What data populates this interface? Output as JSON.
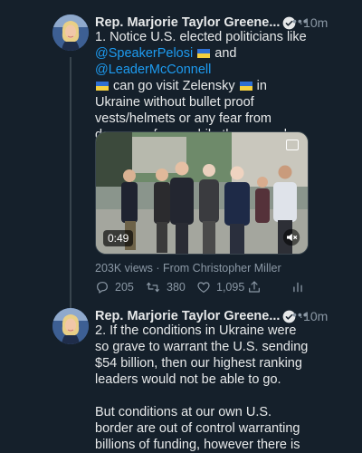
{
  "tweets": [
    {
      "author": "Rep. Marjorie Taylor Greene...",
      "separator": "·",
      "time": "10m",
      "text": {
        "t1": "1. Notice U.S. elected politicians like",
        "mention1": "@SpeakerPelosi",
        "t2": " and ",
        "mention2": "@LeaderMcConnell",
        "t3": " can go visit Zelensky ",
        "t4": " in Ukraine without bullet proof vests/helmets or any fear from dangers of war, while they eagerly give billions to fund their proxy war w/ Russia."
      },
      "media": {
        "duration": "0:49"
      },
      "views": "203K views · From Christopher Miller",
      "actions": {
        "replies": "205",
        "retweets": "380",
        "likes": "1,095"
      }
    },
    {
      "author": "Rep. Marjorie Taylor Greene...",
      "separator": "·",
      "time": "10m",
      "text": {
        "p1": "2. If the conditions in Ukraine were so grave to warrant the U.S. sending $54 billion, then our highest ranking leaders would not be able to go.",
        "p2": "But conditions at our own U.S. border are out of control warranting billions of funding, however there is baby formula there."
      }
    }
  ],
  "icons": [
    "verified-icon",
    "more-icon",
    "ukraine-flag-icon",
    "reply-icon",
    "retweet-icon",
    "like-icon",
    "share-icon",
    "stats-icon",
    "mute-icon",
    "pip-icon"
  ],
  "colors": {
    "background": "#15202b",
    "text": "#e7e9ea",
    "secondary": "#8b98a5",
    "link": "#1d9bf0",
    "thread_line": "#38444d"
  }
}
